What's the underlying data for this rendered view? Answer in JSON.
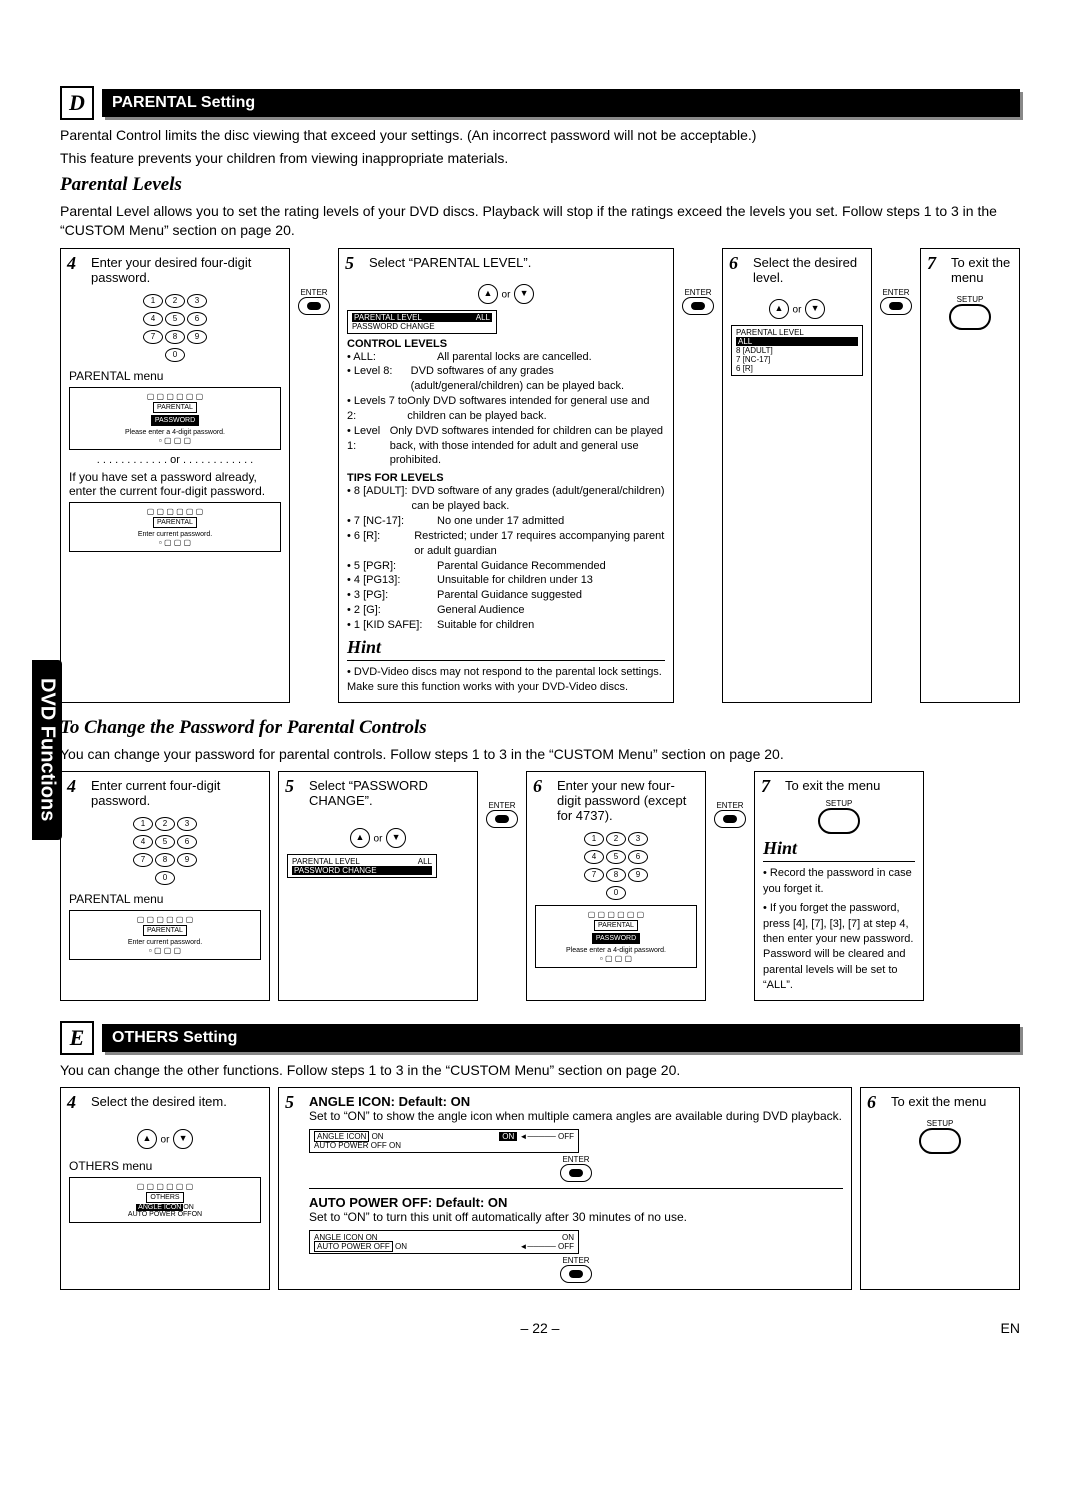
{
  "sidetab": "DVD Functions",
  "sectionD": {
    "letter": "D",
    "title": "PARENTAL Setting",
    "intro1": "Parental Control limits the disc viewing that exceed your settings. (An incorrect password will not be acceptable.)",
    "intro2": "This feature prevents your children from viewing inappropriate materials.",
    "sub1": "Parental Levels",
    "sub1text": "Parental Level allows you to set the rating levels of your DVD discs. Playback will stop if the ratings exceed the levels you set. Follow steps 1 to 3 in the “CUSTOM Menu” section on page 20.",
    "steps1": {
      "s4num": "4",
      "s4": "Enter your desired four-digit password.",
      "s4label": "PARENTAL menu",
      "s4or": "or",
      "s4note": "If you have set a password already, enter the current four-digit password.",
      "s5num": "5",
      "s5": "Select “PARENTAL LEVEL”.",
      "s5or": "or",
      "s6num": "6",
      "s6": "Select the desired level.",
      "s6or": "or",
      "s7num": "7",
      "s7": "To exit the menu",
      "enter": "ENTER",
      "setup": "SETUP"
    },
    "menuD1": {
      "title": "PARENTAL",
      "inv": "PASSWORD",
      "msg": "Please enter a 4-digit password."
    },
    "menuD2": {
      "title": "PARENTAL",
      "msg": "Enter current password."
    },
    "listD5": {
      "h": "PARENTAL LEVEL",
      "i1": "ALL",
      "i2": "PASSWORD CHANGE"
    },
    "listD6": {
      "h": "PARENTAL LEVEL",
      "i1": "ALL",
      "i2": "8 [ADULT]",
      "i3": "7 [NC-17]",
      "i4": "6 [R]"
    },
    "ctrlLevels": {
      "heading": "CONTROL LEVELS",
      "r1l": "• ALL:",
      "r1t": "All parental locks are cancelled.",
      "r2l": "• Level 8:",
      "r2t": "DVD softwares of any grades (adult/general/children) can be played back.",
      "r3l": "• Levels 7 to 2:",
      "r3t": "Only DVD softwares intended for general use and children can be played back.",
      "r4l": "• Level 1:",
      "r4t": "Only DVD softwares intended for children can be played back, with those intended for adult and general use prohibited."
    },
    "tips": {
      "heading": "TIPS FOR LEVELS",
      "r1l": "• 8 [ADULT]:",
      "r1t": "DVD software of any grades (adult/general/children) can be played back.",
      "r2l": "• 7 [NC-17]:",
      "r2t": "No one under 17 admitted",
      "r3l": "• 6 [R]:",
      "r3t": "Restricted; under 17 requires accompanying parent or adult guardian",
      "r4l": "• 5 [PGR]:",
      "r4t": "Parental Guidance Recommended",
      "r5l": "• 4 [PG13]:",
      "r5t": "Unsuitable for children under 13",
      "r6l": "• 3 [PG]:",
      "r6t": "Parental Guidance suggested",
      "r7l": "• 2 [G]:",
      "r7t": "General Audience",
      "r8l": "• 1 [KID SAFE]:",
      "r8t": "Suitable for children"
    },
    "hint1head": "Hint",
    "hint1text": "• DVD-Video discs may not respond to the parental lock settings. Make sure this function works with your DVD-Video discs.",
    "sub2": "To Change the Password for Parental Controls",
    "sub2text": "You can change your password for parental controls. Follow steps 1 to 3 in the “CUSTOM Menu” section on page 20.",
    "steps2": {
      "s4num": "4",
      "s4": "Enter current four-digit password.",
      "s4label": "PARENTAL menu",
      "s5num": "5",
      "s5": "Select “PASSWORD CHANGE”.",
      "s5or": "or",
      "s6num": "6",
      "s6": "Enter your new four-digit password (except for 4737).",
      "s7num": "7",
      "s7": "To exit the menu",
      "enter": "ENTER",
      "setup": "SETUP"
    },
    "menuP1": {
      "title": "PARENTAL",
      "msg": "Enter current password."
    },
    "listP5": {
      "h": "PARENTAL LEVEL",
      "i1": "ALL",
      "i2": "PASSWORD CHANGE"
    },
    "menuP6": {
      "title": "PARENTAL",
      "inv": "PASSWORD",
      "msg": "Please enter a 4-digit password."
    },
    "hint2head": "Hint",
    "hint2t1": "• Record the password in case you forget it.",
    "hint2t2": "• If you forget the password, press [4], [7], [3], [7] at step 4, then enter your new password. Password will be cleared and parental levels will be set to “ALL”."
  },
  "sectionE": {
    "letter": "E",
    "title": "OTHERS Setting",
    "intro": "You can change the other functions. Follow steps 1 to 3 in the “CUSTOM Menu” section on page 20.",
    "steps": {
      "s4num": "4",
      "s4": "Select the desired item.",
      "s4label": "OTHERS menu",
      "s4or": "or",
      "s5num": "5",
      "s5h1": "ANGLE ICON:",
      "s5d1": "Default: ON",
      "s5t1": "Set to “ON” to show the angle icon when multiple camera angles are available during DVD playback.",
      "s5h2": "AUTO POWER OFF:",
      "s5d2": "Default: ON",
      "s5t2": "Set to “ON” to turn this unit off automatically after 30 minutes of no use.",
      "s6num": "6",
      "s6": "To exit the menu",
      "enter": "ENTER",
      "setup": "SETUP"
    },
    "menuE": {
      "title": "OTHERS",
      "l1": "ANGLE ICON",
      "l1v": "ON",
      "l2": "AUTO POWER OFF",
      "l2v": "ON"
    },
    "listE1": {
      "l1": "ANGLE ICON",
      "l1v": "ON",
      "l1a": "ON",
      "l1b": "OFF",
      "l2": "AUTO POWER OFF",
      "l2v": "ON"
    },
    "listE2": {
      "l1": "ANGLE ICON",
      "l1v": "ON",
      "l2": "AUTO POWER OFF",
      "l2v": "ON",
      "l2a": "ON",
      "l2b": "OFF"
    }
  },
  "footer": {
    "page": "– 22 –",
    "lang": "EN"
  }
}
